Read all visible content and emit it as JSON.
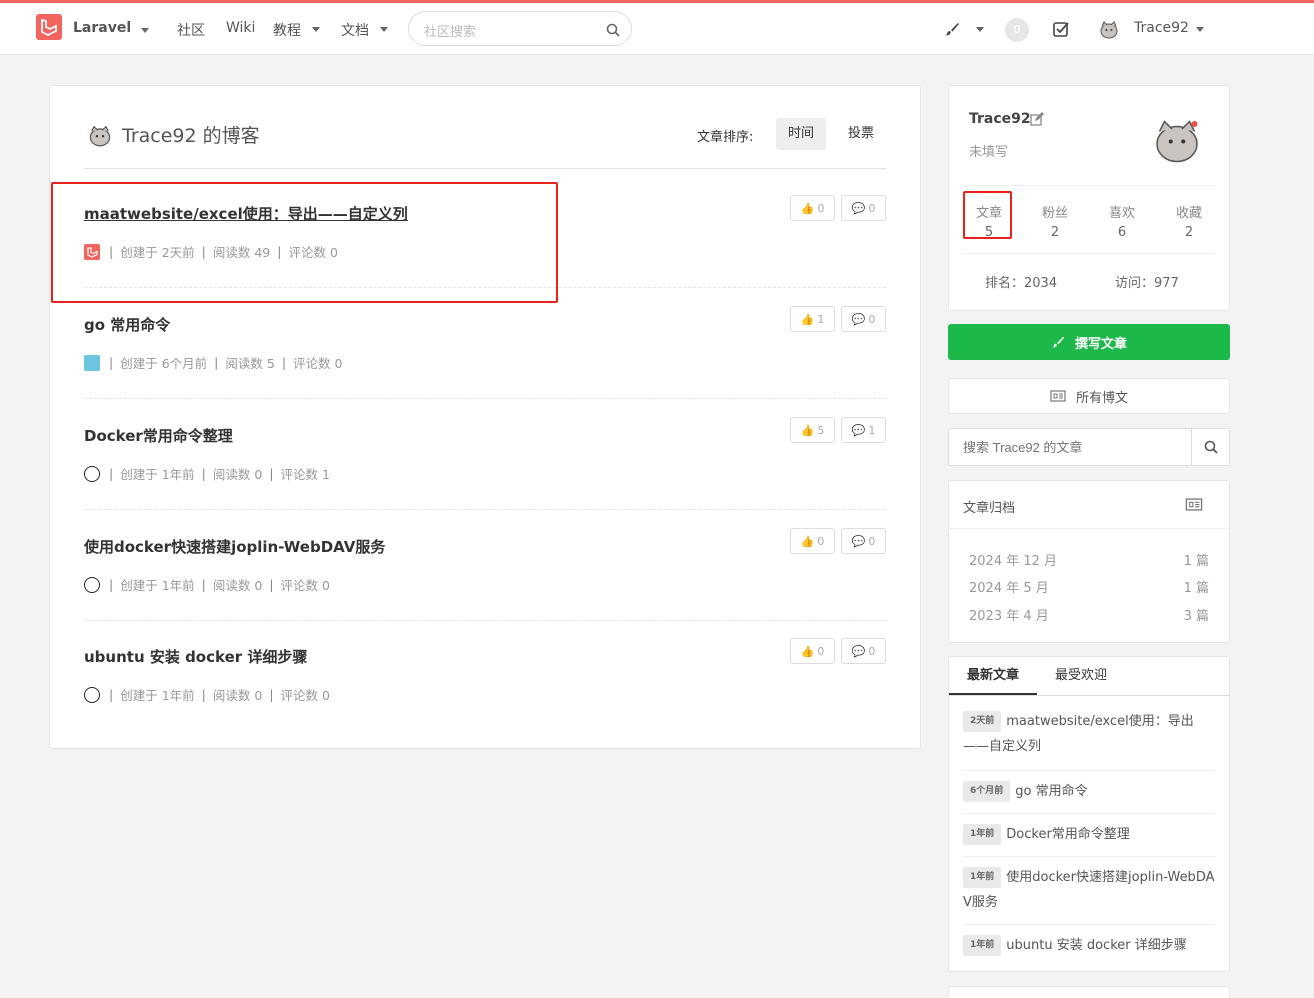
{
  "nav": {
    "brand": "Laravel",
    "community": "社区",
    "wiki": "Wiki",
    "tutorial": "教程",
    "docs": "文档",
    "search_placeholder": "社区搜索",
    "notify_count": "0",
    "user": "Trace92"
  },
  "blog": {
    "title": "Trace92 的博客",
    "sort_label": "文章排序:",
    "sort_time": "时间",
    "sort_vote": "投票"
  },
  "articles": [
    {
      "title": "maatwebsite/excel使用：导出——自定义列",
      "meta": [
        "创建于 2天前",
        "阅读数 49",
        "评论数 0"
      ],
      "likes": "0",
      "comments": "0"
    },
    {
      "title": "go 常用命令",
      "meta": [
        "创建于 6个月前",
        "阅读数 5",
        "评论数 0"
      ],
      "likes": "1",
      "comments": "0"
    },
    {
      "title": "Docker常用命令整理",
      "meta": [
        "创建于 1年前",
        "阅读数 0",
        "评论数 1"
      ],
      "likes": "5",
      "comments": "1"
    },
    {
      "title": "使用docker快速搭建joplin-WebDAV服务",
      "meta": [
        "创建于 1年前",
        "阅读数 0",
        "评论数 0"
      ],
      "likes": "0",
      "comments": "0"
    },
    {
      "title": "ubuntu 安装 docker 详细步骤",
      "meta": [
        "创建于 1年前",
        "阅读数 0",
        "评论数 0"
      ],
      "likes": "0",
      "comments": "0"
    }
  ],
  "profile": {
    "name": "Trace92",
    "bio": "未填写",
    "stats": [
      {
        "label": "文章",
        "value": "5"
      },
      {
        "label": "粉丝",
        "value": "2"
      },
      {
        "label": "喜欢",
        "value": "6"
      },
      {
        "label": "收藏",
        "value": "2"
      }
    ],
    "rank": "排名：2034",
    "visits": "访问：977"
  },
  "sidebar": {
    "write_button": "撰写文章",
    "all_posts": "所有博文",
    "search_placeholder": "搜索 Trace92 的文章"
  },
  "archive": {
    "title": "文章归档",
    "rows": [
      {
        "month": "2024 年 12 月",
        "count": "1 篇"
      },
      {
        "month": "2024 年 5 月",
        "count": "1 篇"
      },
      {
        "month": "2023 年 4 月",
        "count": "3 篇"
      }
    ]
  },
  "latest": {
    "tabs": [
      "最新文章",
      "最受欢迎"
    ],
    "items": [
      {
        "tag": "2天前",
        "title": "maatwebsite/excel使用：导出——自定义列"
      },
      {
        "tag": "6个月前",
        "title": "go 常用命令"
      },
      {
        "tag": "1年前",
        "title": "Docker常用命令整理"
      },
      {
        "tag": "1年前",
        "title": "使用docker快速搭建joplin-WebDAV服务"
      },
      {
        "tag": "1年前",
        "title": "ubuntu 安装 docker 详细步骤"
      }
    ]
  },
  "colors": {
    "accent": "#f4645f",
    "green": "#1cb84a",
    "highlight": "#e8231e"
  }
}
